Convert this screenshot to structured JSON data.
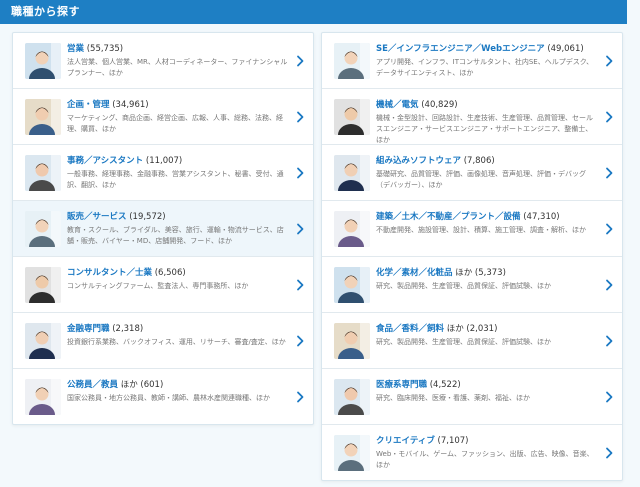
{
  "header": {
    "title": "職種から探す"
  },
  "colors": {
    "accent": "#1e7fc4",
    "link": "#1a78c2"
  },
  "left": [
    {
      "title": "営業",
      "count": "(55,735)",
      "desc": "法人営業、個人営業、MR、人材コーディネーター、ファイナンシャルプランナー、ほか",
      "icon": "person-suit-phone"
    },
    {
      "title": "企画・管理",
      "count": "(34,961)",
      "desc": "マーケティング、商品企画、経営企画、広報、人事、総務、法務、経理、購買、ほか",
      "icon": "person-laptop"
    },
    {
      "title": "事務／アシスタント",
      "count": "(11,007)",
      "desc": "一般事務、経理事務、金融事務、営業アシスタント、秘書、受付、通訳、翻訳、ほか",
      "icon": "person-headset"
    },
    {
      "title": "販売／サービス",
      "count": "(19,572)",
      "desc": "教育・スクール、ブライダル、美容、旅行、運輸・物流サービス、店舗・販売、バイヤー・MD、店舗開発、フード、ほか",
      "icon": "person-apron"
    },
    {
      "title": "コンサルタント／士業",
      "count": "(6,506)",
      "desc": "コンサルティングファーム、監査法人、専門事務所、ほか",
      "icon": "person-meeting"
    },
    {
      "title": "金融専門職",
      "count": "(2,318)",
      "desc": "投資銀行系業務、バックオフィス、運用、リサーチ、審査/査定、ほか",
      "icon": "person-finance"
    },
    {
      "title": "公務員／教員",
      "count": "ほか (601)",
      "desc": "国家公務員・地方公務員、教師・講師、農林水産関連職種、ほか",
      "icon": "person-teacher"
    }
  ],
  "right": [
    {
      "title": "SE／インフラエンジニア／Webエンジニア",
      "count": "(49,061)",
      "desc": "アプリ開発、インフラ、ITコンサルタント、社内SE、ヘルプデスク、データサイエンティスト、ほか",
      "icon": "person-it"
    },
    {
      "title": "機械／電気",
      "count": "(40,829)",
      "desc": "機械・金型設計、回路設計、生産技術、生産管理、品質管理、セールスエンジニア・サービスエンジニア・サポートエンジニア、整備士、ほか",
      "icon": "person-engineer"
    },
    {
      "title": "組み込みソフトウェア",
      "count": "(7,806)",
      "desc": "基礎研究、品質管理、評価、画像処理、音声処理、評価・デバッグ（デバッガー）、ほか",
      "icon": "person-embedded"
    },
    {
      "title": "建築／土木／不動産／プラント／設備",
      "count": "(47,310)",
      "desc": "不動産開発、施設管理、設計、積算、施工管理、調査・解析、ほか",
      "icon": "person-construction"
    },
    {
      "title": "化学／素材／化粧品",
      "count": "ほか (5,373)",
      "desc": "研究、製品開発、生産管理、品質保証、評価試験、ほか",
      "icon": "person-lab"
    },
    {
      "title": "食品／香料／飼料",
      "count": "ほか (2,031)",
      "desc": "研究、製品開発、生産管理、品質保証、評価試験、ほか",
      "icon": "person-food"
    },
    {
      "title": "医療系専門職",
      "count": "(4,522)",
      "desc": "研究、臨床開発、医療・看護、薬剤、福祉、ほか",
      "icon": "person-medical"
    },
    {
      "title": "クリエイティブ",
      "count": "(7,107)",
      "desc": "Web・モバイル、ゲーム、ファッション、出版、広告、映像、音楽、ほか",
      "icon": "person-creative"
    }
  ]
}
